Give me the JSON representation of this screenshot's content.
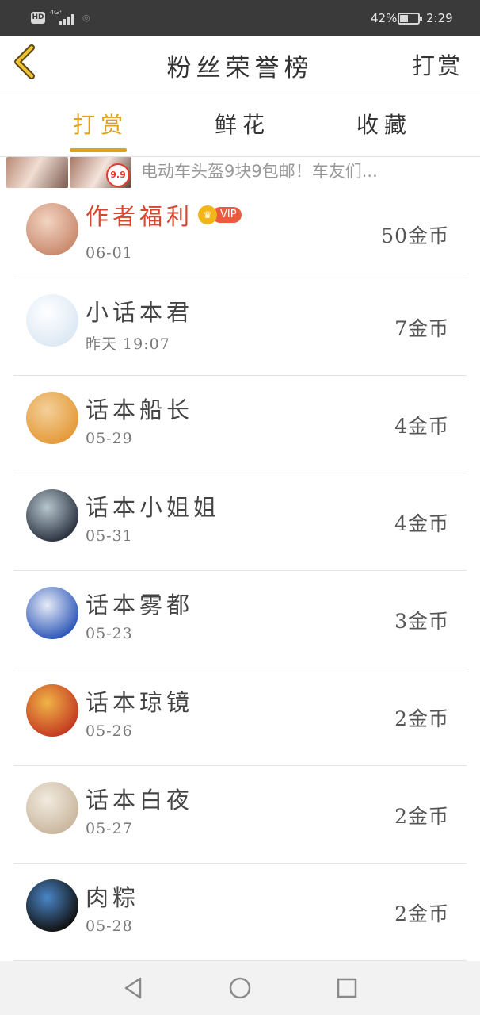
{
  "status_bar": {
    "hd": "HD",
    "network": "4G⁺",
    "battery_percent": "42%",
    "battery_level": 0.42,
    "time": "2:29"
  },
  "header": {
    "title": "粉丝荣誉榜",
    "action": "打赏",
    "back_icon": "chevron-left-icon",
    "accent_color": "#e0a11b"
  },
  "tabs": [
    {
      "label": "打赏",
      "active": true
    },
    {
      "label": "鲜花",
      "active": false
    },
    {
      "label": "收藏",
      "active": false
    }
  ],
  "ad": {
    "text": "电动车头盔9块9包邮！车友们...",
    "price_tag": "9.9"
  },
  "list": [
    {
      "name": "作者福利",
      "vip": true,
      "vip_label": "VIP",
      "date": "06-01",
      "amount": "50金币",
      "avatar_colors": [
        "#c98a6e",
        "#f3d4c2"
      ]
    },
    {
      "name": "小话本君",
      "vip": false,
      "date": "昨天 19:07",
      "amount": "7金币",
      "avatar_colors": [
        "#dce8f4",
        "#ffffff"
      ]
    },
    {
      "name": "话本船长",
      "vip": false,
      "date": "05-29",
      "amount": "4金币",
      "avatar_colors": [
        "#e59a3a",
        "#f3d09a"
      ]
    },
    {
      "name": "话本小姐姐",
      "vip": false,
      "date": "05-31",
      "amount": "4金币",
      "avatar_colors": [
        "#2b3340",
        "#b7c6cf"
      ]
    },
    {
      "name": "话本雾都",
      "vip": false,
      "date": "05-23",
      "amount": "3金币",
      "avatar_colors": [
        "#2f58b8",
        "#e6ecf7"
      ]
    },
    {
      "name": "话本琼镜",
      "vip": false,
      "date": "05-26",
      "amount": "2金币",
      "avatar_colors": [
        "#c43a22",
        "#f0b447"
      ]
    },
    {
      "name": "话本白夜",
      "vip": false,
      "date": "05-27",
      "amount": "2金币",
      "avatar_colors": [
        "#c9b79e",
        "#f2ebe0"
      ]
    },
    {
      "name": "肉粽",
      "vip": false,
      "date": "05-28",
      "amount": "2金币",
      "avatar_colors": [
        "#111111",
        "#4a86c8"
      ]
    }
  ],
  "nav": {
    "back": "nav-back-icon",
    "home": "nav-home-icon",
    "recent": "nav-recent-icon"
  }
}
